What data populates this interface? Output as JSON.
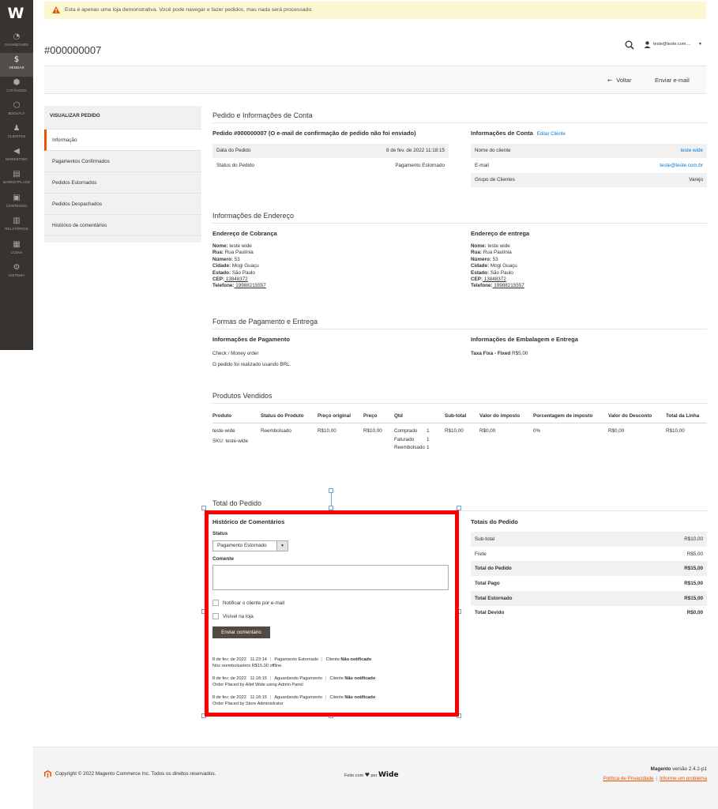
{
  "sidebar": {
    "logo": "W",
    "items": [
      {
        "label": "DASHBOARD",
        "icon": "dashboard-icon",
        "glyph": "◔"
      },
      {
        "label": "VENDAS",
        "icon": "dollar-icon",
        "glyph": "$"
      },
      {
        "label": "CATÁLOGO",
        "icon": "box-icon",
        "glyph": "⬢"
      },
      {
        "label": "BOOLFLY",
        "icon": "hexagon-icon",
        "glyph": "⬡"
      },
      {
        "label": "CLIENTES",
        "icon": "person-icon",
        "glyph": "♟"
      },
      {
        "label": "MARKETING",
        "icon": "megaphone-icon",
        "glyph": "◀"
      },
      {
        "label": "MARKETPLACE",
        "icon": "store-icon",
        "glyph": "▤"
      },
      {
        "label": "CONTEÚDO",
        "icon": "content-icon",
        "glyph": "▣"
      },
      {
        "label": "RELATÓRIOS",
        "icon": "bar-chart-icon",
        "glyph": "▥"
      },
      {
        "label": "LOJAS",
        "icon": "store-front-icon",
        "glyph": "▦"
      },
      {
        "label": "SISTEMA",
        "icon": "gear-icon",
        "glyph": "⚙"
      }
    ]
  },
  "notice": "Esta é apenas uma loja demonstrativa. Você pode navegar e fazer pedidos, mas nada será processado.",
  "header": {
    "title": "#000000007",
    "user": "teste@teste.com....",
    "caret": "▼"
  },
  "actions": {
    "back": "Voltar",
    "back_arrow": "←",
    "email": "Enviar e-mail"
  },
  "tabs": {
    "title": "VISUALIZAR PEDIDO",
    "items": [
      "Informação",
      "Pagamentos Confirmados",
      "Pedidos Estornados",
      "Pedidos Despachados",
      "Histórico de comentários"
    ]
  },
  "order_info": {
    "section_title": "Pedido e Informações de Conta",
    "order_heading": "Pedido #000000007 (O e-mail de confirmação de pedido não foi enviado)",
    "date_label": "Data do Pedido",
    "date_value": "8 de fev. de 2022 11:18:15",
    "status_label": "Status do Pedido",
    "status_value": "Pagamento Estornado",
    "account_heading": "Informações de Conta",
    "edit_customer": "Editar Cliente",
    "customer_name_label": "Nome do cliente",
    "customer_name_value": "teste wide",
    "email_label": "E-mail",
    "email_value": "teste@teste.com.br",
    "group_label": "Grupo de Clientes",
    "group_value": "Varejo"
  },
  "address": {
    "section_title": "Informações de Endereço",
    "billing_heading": "Endereço de Cobrança",
    "shipping_heading": "Endereço de entrega",
    "lines": [
      {
        "label": "Nome:",
        "value": " teste wide"
      },
      {
        "label": "Rua:",
        "value": " Rua Paulínia"
      },
      {
        "label": "Número:",
        "value": " 53"
      },
      {
        "label": "Cidade:",
        "value": " Mogi Guaçu"
      },
      {
        "label": "Estado:",
        "value": " São Paulo"
      },
      {
        "label": "CEP:",
        "value": " 13848372"
      },
      {
        "label": "Telefone:",
        "value": " 19988215557"
      }
    ]
  },
  "payment": {
    "section_title": "Formas de Pagamento e Entrega",
    "payment_heading": "Informações de Pagamento",
    "method": "Check / Money order",
    "currency_note": "O pedido foi realizado usando BRL.",
    "shipping_heading": "Informações de Embalagem e Entrega",
    "shipping_method": "Taxa Fixa - Fixed",
    "shipping_price": " R$5,00"
  },
  "items": {
    "section_title": "Produtos Vendidos",
    "columns": [
      "Produto",
      "Status do Produto",
      "Preço original",
      "Preço",
      "Qtd",
      "Sub-total",
      "Valor do imposto",
      "Porcentagem de imposto",
      "Valor do Desconto",
      "Total da Linha"
    ],
    "row": {
      "product": "teste-wide",
      "sku": "SKU: teste-wide",
      "status": "Reembolsado",
      "original_price": "R$10,00",
      "price": "R$10,00",
      "qty": [
        {
          "label": "Comprado",
          "value": "1"
        },
        {
          "label": "Faturado",
          "value": "1"
        },
        {
          "label": "Reembolsado",
          "value": "1"
        }
      ],
      "subtotal": "R$10,00",
      "tax": "R$0,00",
      "tax_percent": "0%",
      "discount": "R$0,00",
      "row_total": "R$10,00"
    }
  },
  "totals_section": {
    "section_title": "Total do Pedido",
    "history_heading": "Histórico de Comentários",
    "status_label": "Status",
    "status_selected": "Pagamento Estornado",
    "comment_label": "Comente",
    "notify_label": "Notificar o cliente por e-mail",
    "visible_label": "Visível na loja",
    "submit": "Enviar comentário",
    "history": [
      {
        "date": "8 de fev. de 2022",
        "time": "11:23:14",
        "status": "Pagamento Estornado",
        "customer": "Cliente",
        "notified": "Não notificado",
        "note": "Nós reembolsamos R$15,00 offline."
      },
      {
        "date": "8 de fev. de 2022",
        "time": "11:18:15",
        "status": "Aguardando Pagamento",
        "customer": "Cliente",
        "notified": "Não notificado",
        "note": "Order Placed by Allef Wide using Admin Panel"
      },
      {
        "date": "8 de fev. de 2022",
        "time": "11:18:15",
        "status": "Aguardando Pagamento",
        "customer": "Cliente",
        "notified": "Não notificado",
        "note": "Order Placed by Store Administrator"
      }
    ],
    "totals_heading": "Totais do Pedido",
    "totals": [
      {
        "label": "Sub-total",
        "value": "R$10,00"
      },
      {
        "label": "Frete",
        "value": "R$5,00"
      },
      {
        "label": "Total do Pedido",
        "value": "R$15,00"
      },
      {
        "label": "Total Pago",
        "value": "R$15,00"
      },
      {
        "label": "Total Estornado",
        "value": "R$15,00"
      },
      {
        "label": "Total Devido",
        "value": "R$0,00"
      }
    ]
  },
  "footer": {
    "copyright": "Copyright © 2022 Magento Commerce Inc. Todos os direitos reservados.",
    "made_with": "Feito com",
    "heart": "♥",
    "by": "por",
    "wide": "Wide",
    "version_name": "Magento",
    "version": " versão 2.4.2-p1",
    "privacy": "Política de Privacidade",
    "report": "Informe um problema",
    "bar": "|"
  },
  "colors": {
    "accent": "#eb5202",
    "sidebar": "#373330",
    "link": "#007bdb",
    "highlight": "#ff0000"
  }
}
